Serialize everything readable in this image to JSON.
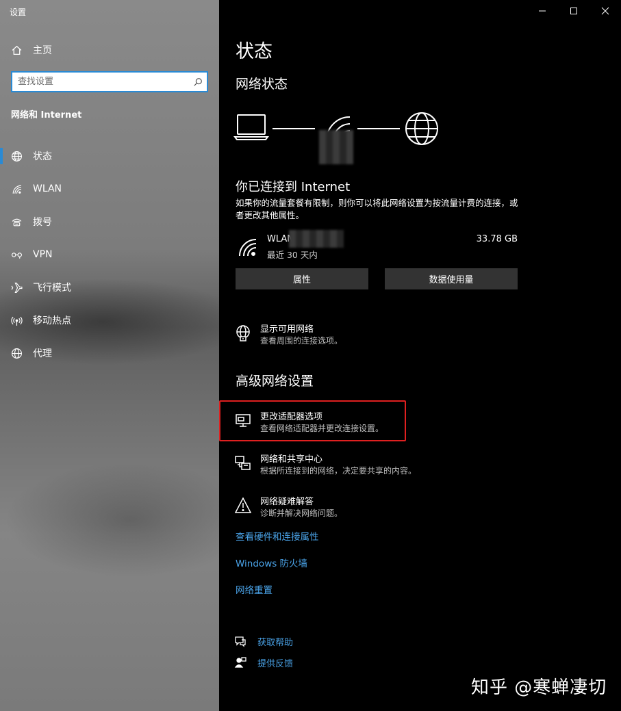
{
  "window": {
    "title": "设置",
    "minimize_icon": "minimize-icon",
    "maximize_icon": "maximize-icon",
    "close_icon": "close-icon"
  },
  "sidebar": {
    "home_label": "主页",
    "search_placeholder": "查找设置",
    "section_title": "网络和 Internet",
    "items": [
      {
        "label": "状态",
        "icon": "globe-status-icon",
        "active": true
      },
      {
        "label": "WLAN",
        "icon": "wifi-icon",
        "active": false
      },
      {
        "label": "拨号",
        "icon": "dialup-icon",
        "active": false
      },
      {
        "label": "VPN",
        "icon": "vpn-icon",
        "active": false
      },
      {
        "label": "飞行模式",
        "icon": "airplane-icon",
        "active": false
      },
      {
        "label": "移动热点",
        "icon": "hotspot-icon",
        "active": false
      },
      {
        "label": "代理",
        "icon": "globe-icon",
        "active": false
      }
    ]
  },
  "main": {
    "page_title": "状态",
    "network_status_title": "网络状态",
    "connected_title": "你已连接到 Internet",
    "connected_desc": "如果你的流量套餐有限制，则你可以将此网络设置为按流量计费的连接，或者更改其他属性。",
    "network": {
      "name": "WLAN",
      "sub": "最近 30 天内",
      "usage": "33.78 GB"
    },
    "buttons": {
      "properties": "属性",
      "data_usage": "数据使用量"
    },
    "show_networks": {
      "title": "显示可用网络",
      "desc": "查看周围的连接选项。"
    },
    "advanced_title": "高级网络设置",
    "advanced_items": [
      {
        "title": "更改适配器选项",
        "desc": "查看网络适配器并更改连接设置。",
        "icon": "adapter-icon",
        "highlighted": true
      },
      {
        "title": "网络和共享中心",
        "desc": "根据所连接到的网络，决定要共享的内容。",
        "icon": "sharing-center-icon"
      },
      {
        "title": "网络疑难解答",
        "desc": "诊断并解决网络问题。",
        "icon": "warning-icon"
      }
    ],
    "links": [
      "查看硬件和连接属性",
      "Windows 防火墙",
      "网络重置"
    ],
    "help": [
      {
        "label": "获取帮助",
        "icon": "help-chat-icon"
      },
      {
        "label": "提供反馈",
        "icon": "feedback-icon"
      }
    ],
    "watermark": "知乎 @寒蝉凄切"
  },
  "colors": {
    "accent": "#2a8ad4",
    "link": "#4aa3e8",
    "highlight_border": "#e02020",
    "button_bg": "#333333"
  }
}
